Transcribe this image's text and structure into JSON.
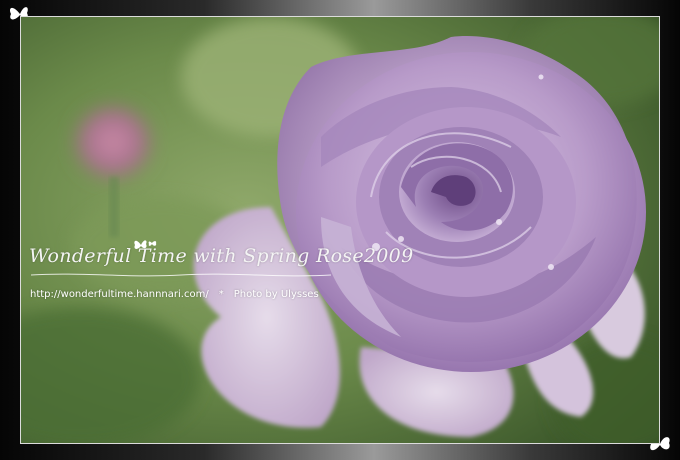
{
  "watermark": {
    "signature": "Wonderful Time with Spring Rose2009",
    "url": "http://wonderfultime.hannnari.com/",
    "separator": "*",
    "credit": "Photo by  Ulysses"
  },
  "icons": {
    "corner_top_left": "butterfly-icon",
    "corner_bottom_right": "butterfly-icon",
    "signature_mark": "butterfly-icon"
  },
  "colors": {
    "frame": "#1a1a1a",
    "background_green": "#6f8f4e",
    "rose_petal": "#b69ac6",
    "rose_shadow": "#7d5d97",
    "watermark_text": "#ffffff"
  }
}
